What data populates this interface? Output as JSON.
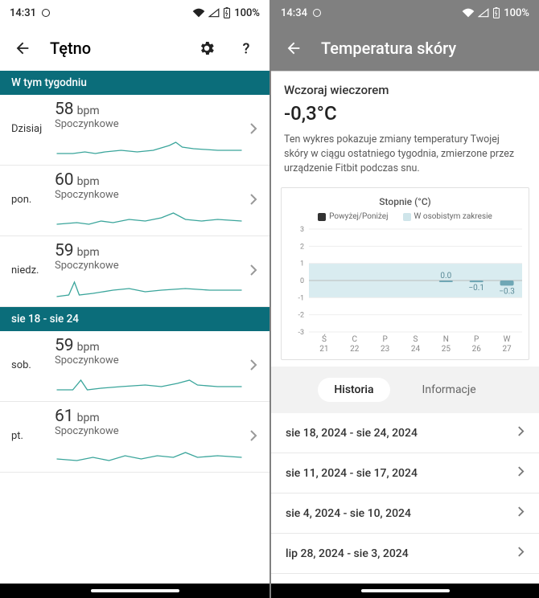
{
  "left": {
    "status": {
      "time": "14:31",
      "battery": "100%"
    },
    "title": "Tętno",
    "sections": [
      {
        "header": "W tym tygodniu",
        "rows": [
          {
            "day": "Dzisiaj",
            "bpm": "58",
            "unit": "bpm",
            "sub": "Spoczynkowe"
          },
          {
            "day": "pon.",
            "bpm": "60",
            "unit": "bpm",
            "sub": "Spoczynkowe"
          },
          {
            "day": "niedz.",
            "bpm": "59",
            "unit": "bpm",
            "sub": "Spoczynkowe"
          }
        ]
      },
      {
        "header": "sie 18 - sie 24",
        "rows": [
          {
            "day": "sob.",
            "bpm": "59",
            "unit": "bpm",
            "sub": "Spoczynkowe"
          },
          {
            "day": "pt.",
            "bpm": "61",
            "unit": "bpm",
            "sub": "Spoczynkowe"
          }
        ]
      }
    ]
  },
  "right": {
    "status": {
      "time": "14:34",
      "battery": "100%"
    },
    "title": "Temperatura skóry",
    "eyebrow": "Wczoraj wieczorem",
    "value": "-0,3°C",
    "desc": "Ten wykres pokazuje zmiany temperatury Twojej skóry w ciągu ostatniego tygodnia, zmierzone przez urządzenie Fitbit podczas snu.",
    "chart_title": "Stopnie (°C)",
    "legend": {
      "a": "Powyżej/Poniżej",
      "b": "W osobistym zakresie"
    },
    "tabs": {
      "history": "Historia",
      "info": "Informacje"
    },
    "history": [
      "sie 18, 2024 - sie 24, 2024",
      "sie 11, 2024 - sie 17, 2024",
      "sie 4, 2024 - sie 10, 2024",
      "lip 28, 2024 - sie 3, 2024"
    ]
  },
  "chart_data": {
    "type": "bar",
    "title": "Stopnie (°C)",
    "xlabel": "",
    "ylabel": "",
    "ylim": [
      -3,
      3
    ],
    "categories": [
      "Ś 21",
      "C 22",
      "P 23",
      "S 24",
      "N 25",
      "P 26",
      "W 27"
    ],
    "values": [
      null,
      null,
      null,
      null,
      0.0,
      -0.1,
      -0.3
    ],
    "band": [
      -1,
      1
    ],
    "legend": [
      "Powyżej/Poniżej",
      "W osobistym zakresie"
    ]
  }
}
